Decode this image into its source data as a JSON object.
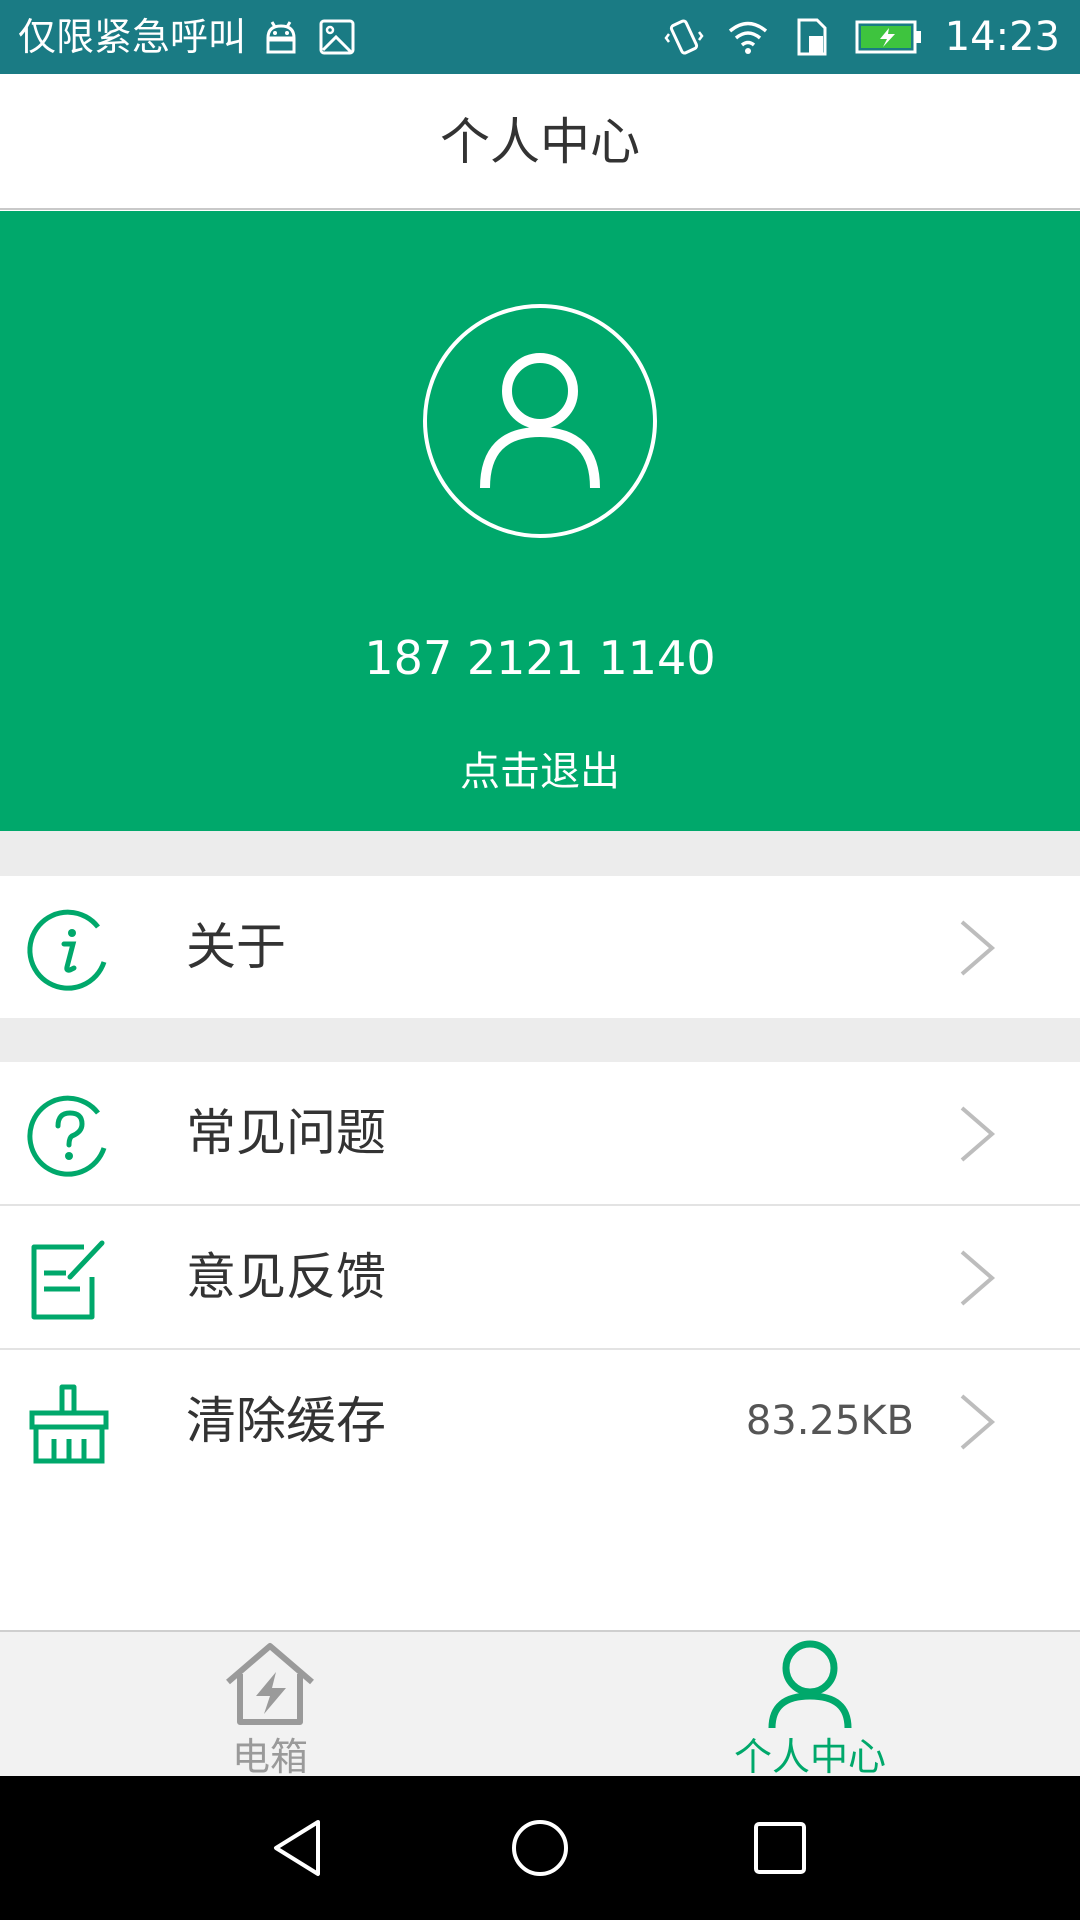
{
  "status_bar": {
    "carrier_text": "仅限紧急呼叫",
    "time": "14:23",
    "left_icons": [
      "android-icon",
      "image-icon"
    ],
    "right_icons": [
      "vibrate-icon",
      "wifi-icon",
      "sim-icon",
      "battery-charging-icon"
    ]
  },
  "header": {
    "title": "个人中心"
  },
  "profile": {
    "avatar_icon": "user-avatar-icon",
    "phone": "187 2121 1140",
    "logout_label": "点击退出"
  },
  "menu": {
    "about": {
      "label": "关于",
      "icon": "info-icon"
    },
    "faq": {
      "label": "常见问题",
      "icon": "question-icon"
    },
    "feedback": {
      "label": "意见反馈",
      "icon": "edit-note-icon"
    },
    "clear_cache": {
      "label": "清除缓存",
      "icon": "broom-icon",
      "value": "83.25KB"
    }
  },
  "bottom_nav": {
    "tabs": [
      {
        "label": "电箱",
        "icon": "power-house-icon",
        "active": false
      },
      {
        "label": "个人中心",
        "icon": "person-icon",
        "active": true
      }
    ]
  },
  "colors": {
    "primary": "#00a86b",
    "status_bar": "#1a7b84",
    "inactive": "#9a9a9a"
  }
}
